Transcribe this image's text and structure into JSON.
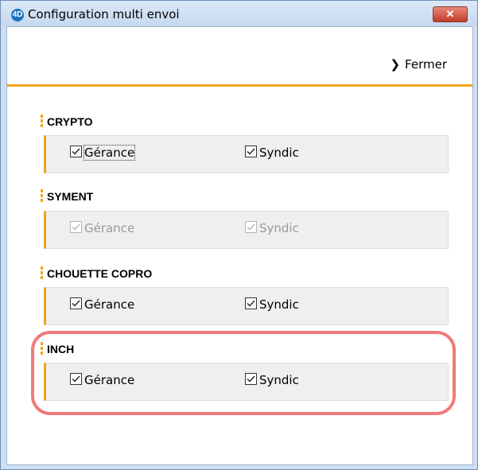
{
  "window": {
    "title": "Configuration multi envoi",
    "app_icon": "4D",
    "close_label": "✕"
  },
  "toolbar": {
    "close_label": "Fermer"
  },
  "colors": {
    "accent": "#f2a31b",
    "highlight": "#f07a7a"
  },
  "sections": [
    {
      "name": "CRYPTO",
      "options": [
        {
          "label": "Gérance",
          "checked": true,
          "disabled": false
        },
        {
          "label": "Syndic",
          "checked": true,
          "disabled": false
        }
      ]
    },
    {
      "name": "SYMENT",
      "options": [
        {
          "label": "Gérance",
          "checked": true,
          "disabled": true
        },
        {
          "label": "Syndic",
          "checked": true,
          "disabled": true
        }
      ]
    },
    {
      "name": "CHOUETTE COPRO",
      "options": [
        {
          "label": "Gérance",
          "checked": true,
          "disabled": false
        },
        {
          "label": "Syndic",
          "checked": true,
          "disabled": false
        }
      ]
    },
    {
      "name": "INCH",
      "options": [
        {
          "label": "Gérance",
          "checked": true,
          "disabled": false
        },
        {
          "label": "Syndic",
          "checked": true,
          "disabled": false
        }
      ]
    }
  ]
}
